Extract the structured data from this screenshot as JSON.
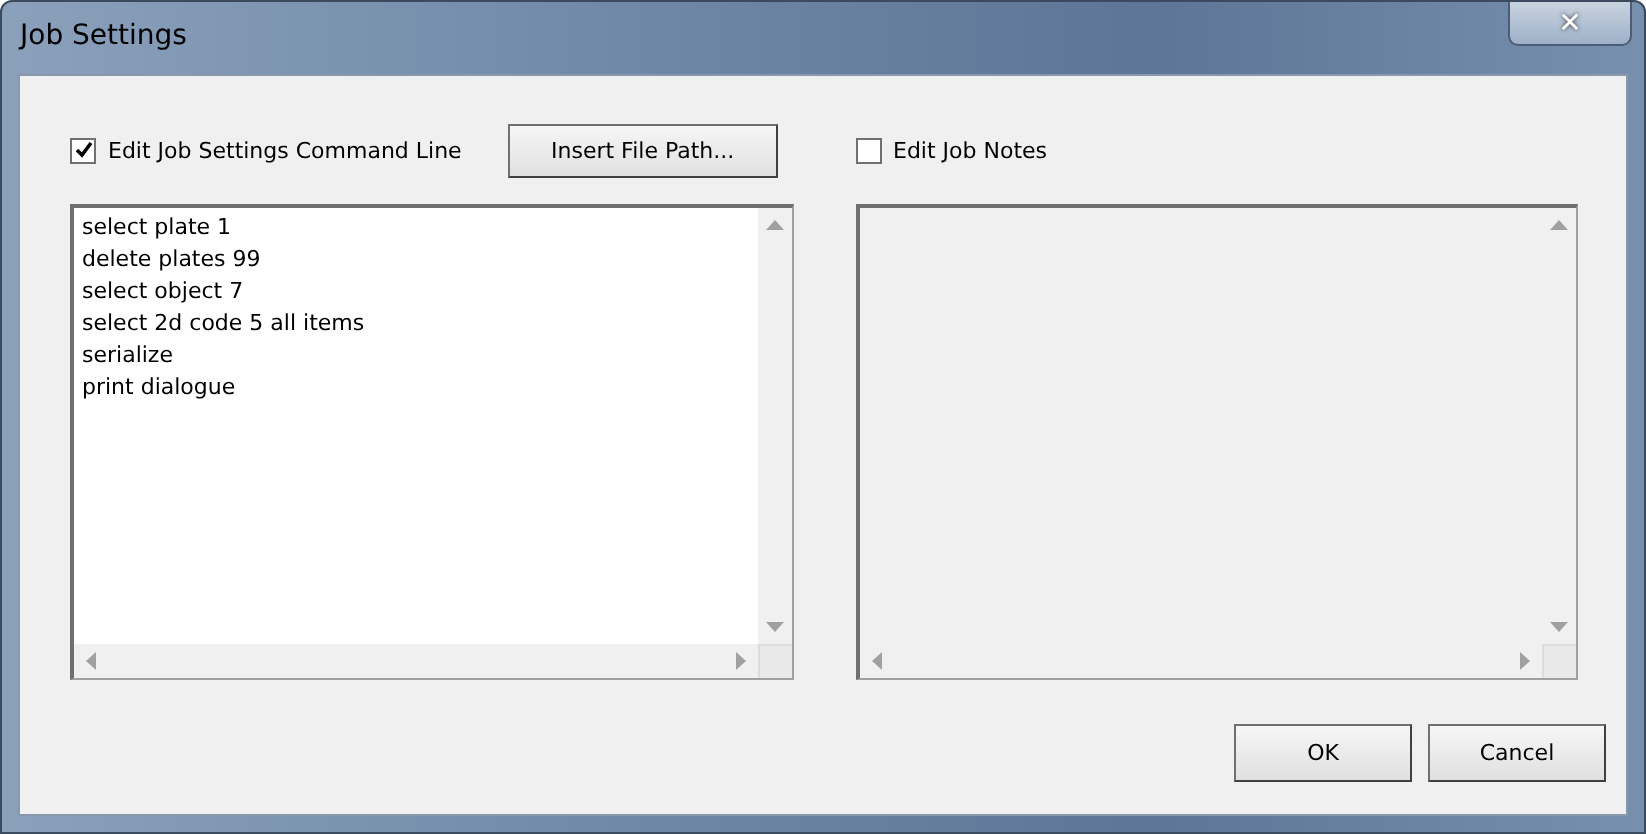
{
  "window": {
    "title": "Job Settings",
    "close_glyph": "✕"
  },
  "panels": [
    {
      "checkbox": {
        "label": "Edit Job Settings Command Line",
        "checked": true
      },
      "button": "Insert File Path...",
      "lines": [
        "select plate 1",
        "delete plates 99",
        "select object 7",
        "select 2d code 5 all items",
        "serialize",
        "print dialogue"
      ]
    },
    {
      "checkbox": {
        "label": "Edit Job Notes",
        "checked": false
      }
    }
  ],
  "buttons": [
    "OK",
    "Cancel"
  ]
}
